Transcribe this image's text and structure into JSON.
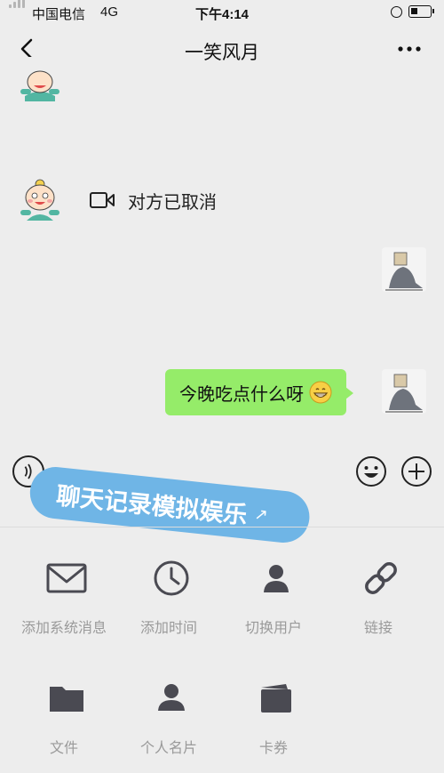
{
  "status_bar": {
    "carrier": "中国电信",
    "network": "4G",
    "time": "下午4:14"
  },
  "nav": {
    "title": "一笑风月"
  },
  "messages": [
    {
      "side": "left",
      "type": "video-call",
      "text": "对方已取消"
    },
    {
      "side": "right",
      "type": "text",
      "text": "今晚吃点什么呀",
      "emoji": "grinning-face-emoji"
    }
  ],
  "banner": {
    "text": "聊天记录模拟娱乐",
    "arrow": "↗"
  },
  "tools": [
    {
      "label": "添加系统消息",
      "icon": "envelope-icon"
    },
    {
      "label": "添加时间",
      "icon": "clock-icon"
    },
    {
      "label": "切换用户",
      "icon": "user-icon"
    },
    {
      "label": "链接",
      "icon": "link-icon"
    },
    {
      "label": "文件",
      "icon": "folder-icon"
    },
    {
      "label": "个人名片",
      "icon": "contact-card-icon"
    },
    {
      "label": "卡券",
      "icon": "wallet-icon"
    }
  ],
  "colors": {
    "background": "#ededed",
    "bubble_green": "#95ec69",
    "banner_blue": "#6fb5e6",
    "tool_icon": "#4a4a52",
    "tool_label": "#9a9a9a"
  }
}
